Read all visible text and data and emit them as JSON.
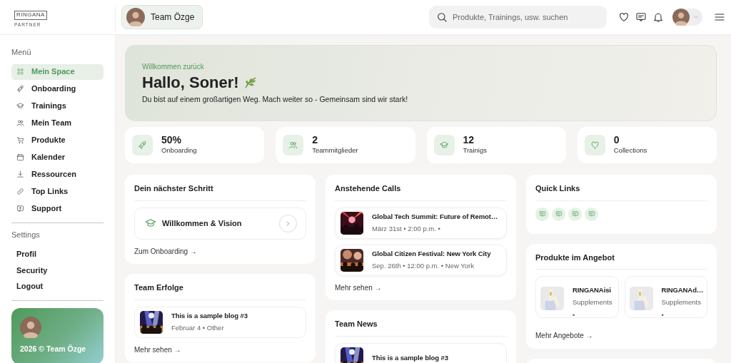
{
  "header": {
    "logo": {
      "wordmark": "RINGANA",
      "tagline": "PARTNER"
    },
    "team_button": {
      "label": "Team Özge"
    },
    "search": {
      "placeholder": "Produkte, Trainings, usw. suchen"
    }
  },
  "sidebar": {
    "menu_title": "Menü",
    "menu_items": [
      {
        "label": "Mein Space",
        "selected": true
      },
      {
        "label": "Onboarding",
        "selected": false
      },
      {
        "label": "Trainings",
        "selected": false
      },
      {
        "label": "Mein Team",
        "selected": false
      },
      {
        "label": "Produkte",
        "selected": false
      },
      {
        "label": "Kalender",
        "selected": false
      },
      {
        "label": "Ressourcen",
        "selected": false
      },
      {
        "label": "Top Links",
        "selected": false
      },
      {
        "label": "Support",
        "selected": false
      }
    ],
    "settings_title": "Settings",
    "settings_items": [
      {
        "label": "Profil"
      },
      {
        "label": "Security"
      },
      {
        "label": "Logout"
      }
    ],
    "footer_card": {
      "text": "2026 © Team Özge"
    }
  },
  "hero": {
    "eyebrow": "Willkommen zurück",
    "title": "Hallo, Soner!",
    "subtitle": "Du bist auf einem großartigen Weg. Mach weiter so - Gemeinsam sind wir stark!"
  },
  "stats": [
    {
      "value": "50%",
      "label": "Onboarding"
    },
    {
      "value": "2",
      "label": "Teammitglieder"
    },
    {
      "value": "12",
      "label": "Trainigs"
    },
    {
      "value": "0",
      "label": "Collections"
    }
  ],
  "next_step": {
    "title": "Dein nächster Schritt",
    "item": "Willkommen & Vision",
    "link": "Zum Onboarding →"
  },
  "team_success": {
    "title": "Team Erfolge",
    "posts": [
      {
        "title": "This is a sample blog #3",
        "meta": "Februar 4 • Other"
      }
    ],
    "link": "Mehr sehen →"
  },
  "calls": {
    "title": "Anstehende Calls",
    "items": [
      {
        "title": "Global Tech Summit: Future of Remot…",
        "meta": "März 31st • 2:00 p.m. •"
      },
      {
        "title": "Global Citizen Festival: New York City",
        "meta": "Sep. 26th • 12:00 p.m. • New York"
      }
    ],
    "link": "Mehr sehen →"
  },
  "team_news": {
    "title": "Team News",
    "posts": [
      {
        "title": "This is a sample blog #3"
      }
    ]
  },
  "quick_links": {
    "title": "Quick Links",
    "links": [
      {
        "kind": "chat"
      },
      {
        "kind": "chat"
      },
      {
        "kind": "chat"
      },
      {
        "kind": "chat"
      }
    ]
  },
  "products": {
    "title": "Produkte im Angebot",
    "items": [
      {
        "name": "RINGANAisi",
        "category": "Supplements",
        "note": "•"
      },
      {
        "name": "RINGANAd…",
        "category": "Supplements",
        "note": "•"
      }
    ],
    "link": "Mehr Angebote →"
  }
}
